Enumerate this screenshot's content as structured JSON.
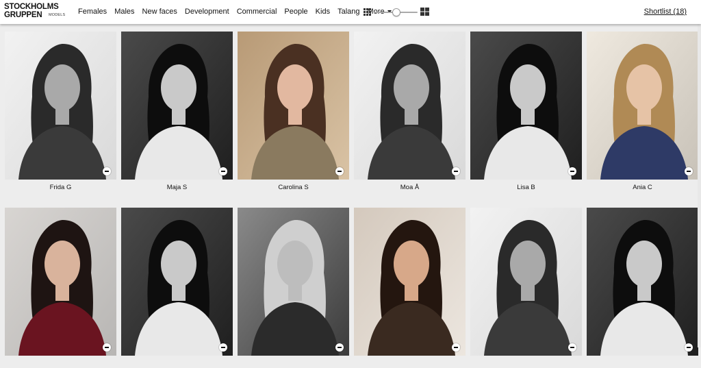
{
  "brand": {
    "line1": "STOCKHOLMS",
    "line2": "GRUPPEN",
    "sub": "MODELS"
  },
  "nav": {
    "items": [
      {
        "label": "Females"
      },
      {
        "label": "Males"
      },
      {
        "label": "New faces"
      },
      {
        "label": "Development"
      },
      {
        "label": "Commercial"
      },
      {
        "label": "People"
      },
      {
        "label": "Kids"
      },
      {
        "label": "Talang"
      }
    ],
    "more_label": "More"
  },
  "view_controls": {
    "small_grid_icon": "grid-small-icon",
    "large_grid_icon": "grid-large-icon",
    "zoom_level": 0.5
  },
  "shortlist": {
    "label": "Shortlist (18)"
  },
  "models": [
    {
      "name": "Frida G",
      "tone": "light-bw"
    },
    {
      "name": "Maja S",
      "tone": "dark-bw"
    },
    {
      "name": "Carolina S",
      "tone": "warm-color"
    },
    {
      "name": "Moa Å",
      "tone": "light-bw"
    },
    {
      "name": "Lisa B",
      "tone": "dark-bw"
    },
    {
      "name": "Ania C",
      "tone": "blue-color"
    },
    {
      "name": "",
      "tone": "red-color"
    },
    {
      "name": "",
      "tone": "dark-bw"
    },
    {
      "name": "",
      "tone": "mid-bw"
    },
    {
      "name": "",
      "tone": "warm-dark"
    },
    {
      "name": "",
      "tone": "light-bw"
    },
    {
      "name": "",
      "tone": "dark-bw"
    }
  ],
  "colors": {
    "header_bg": "#ffffff",
    "page_bg": "#ededed",
    "text": "#111111"
  }
}
